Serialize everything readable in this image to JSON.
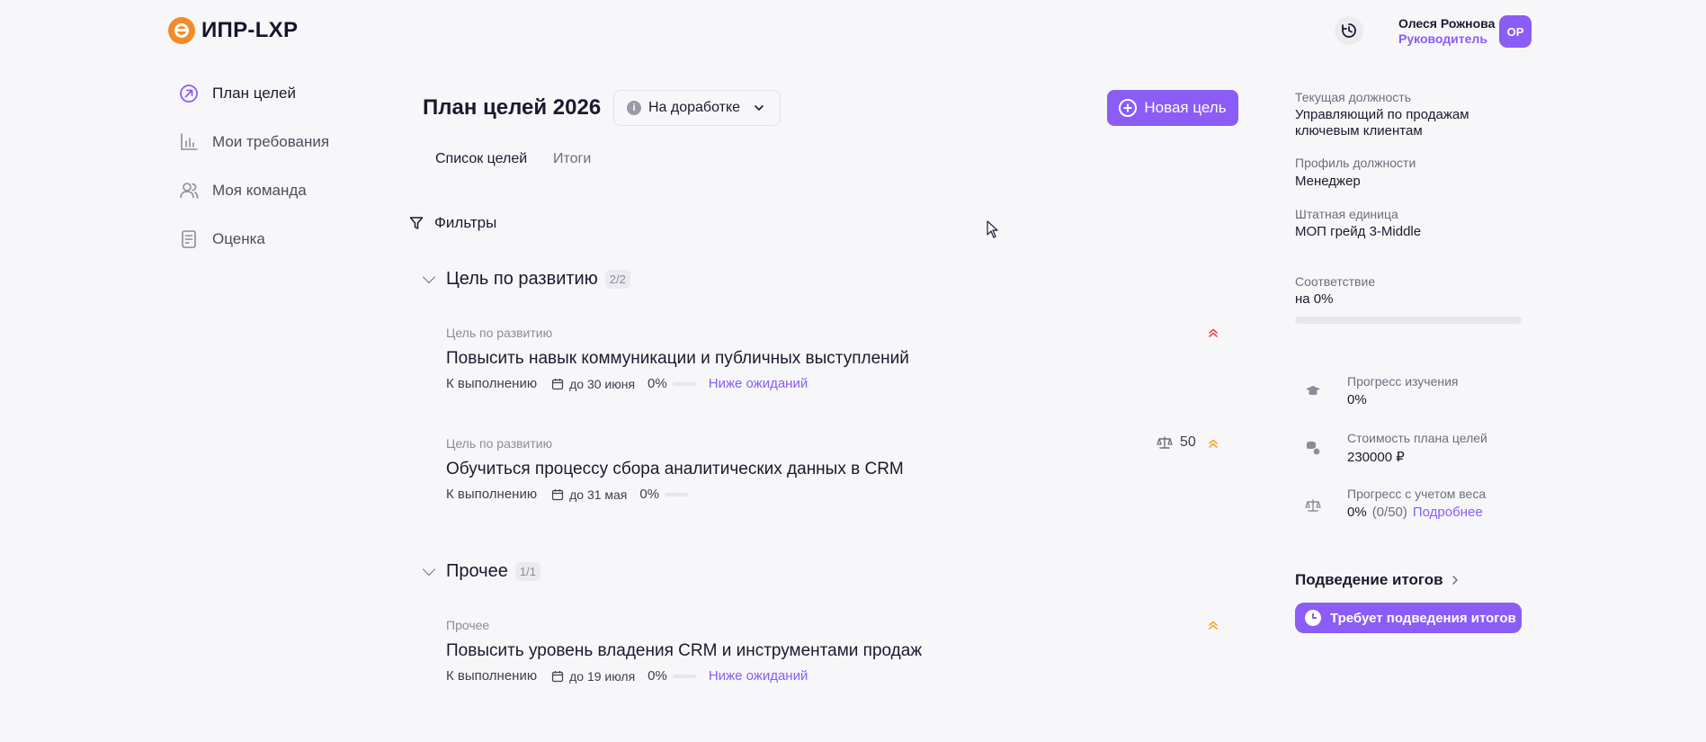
{
  "header": {
    "logo_text": "ИПР-LXP",
    "user_name": "Олеся Рожнова",
    "user_role": "Руководитель",
    "avatar_initials": "ОР"
  },
  "sidebar": {
    "items": [
      {
        "label": "План целей",
        "icon": "arrow-up-right-circle-icon",
        "active": true
      },
      {
        "label": "Мои требования",
        "icon": "chart-bars-icon",
        "active": false
      },
      {
        "label": "Моя команда",
        "icon": "users-icon",
        "active": false
      },
      {
        "label": "Оценка",
        "icon": "document-icon",
        "active": false
      }
    ]
  },
  "main": {
    "title": "План целей 2026",
    "status": "На доработке",
    "new_goal_label": "Новая цель",
    "tabs": [
      {
        "label": "Список целей",
        "active": true
      },
      {
        "label": "Итоги",
        "active": false
      }
    ],
    "filters_label": "Фильтры",
    "groups": [
      {
        "title": "Цель по развитию",
        "count": "2/2",
        "goals": [
          {
            "category": "Цель по развитию",
            "title": "Повысить навык коммуникации и публичных выступлений",
            "status": "К выполнению",
            "deadline": "до 30 июня",
            "progress": "0%",
            "progress_value": 0,
            "evaluation": "Ниже ожиданий",
            "priority_icon": "double-chevron-up-icon",
            "priority_color": "#e5484d"
          },
          {
            "category": "Цель по развитию",
            "title": "Обучиться процессу сбора аналитических данных в CRM",
            "status": "К выполнению",
            "deadline": "до 31 мая",
            "progress": "0%",
            "progress_value": 0,
            "weight": "50",
            "priority_icon": "double-chevron-up-icon",
            "priority_color": "#f5a524"
          }
        ]
      },
      {
        "title": "Прочее",
        "count": "1/1",
        "goals": [
          {
            "category": "Прочее",
            "title": "Повысить уровень владения CRM и инструментами продаж",
            "status": "К выполнению",
            "deadline": "до 19 июля",
            "progress": "0%",
            "progress_value": 0,
            "evaluation": "Ниже ожиданий",
            "priority_icon": "double-chevron-up-icon",
            "priority_color": "#f5a524"
          }
        ]
      }
    ]
  },
  "panel": {
    "position_label": "Текущая должность",
    "position_value": "Управляющий по продажам ключевым клиентам",
    "profile_label": "Профиль должности",
    "profile_value": "Менеджер",
    "unit_label": "Штатная единица",
    "unit_value": "МОП грейд 3-Middle",
    "match_label": "Соответствие",
    "match_value": "на 0%",
    "match_percent": 0,
    "stats": [
      {
        "label": "Прогресс изучения",
        "value": "0%",
        "icon": "graduation-cap-icon"
      },
      {
        "label": "Стоимость плана целей",
        "value": "230000 ₽",
        "icon": "coins-icon"
      },
      {
        "label": "Прогресс с учетом веса",
        "value": "0%",
        "extra": "(0/50)",
        "link": "Подробнее",
        "icon": "scales-icon"
      }
    ],
    "summary_link": "Подведение итогов",
    "summary_button": "Требует подведения итогов"
  },
  "colors": {
    "accent": "#8b5cf6",
    "logo": "#f58a2a"
  }
}
